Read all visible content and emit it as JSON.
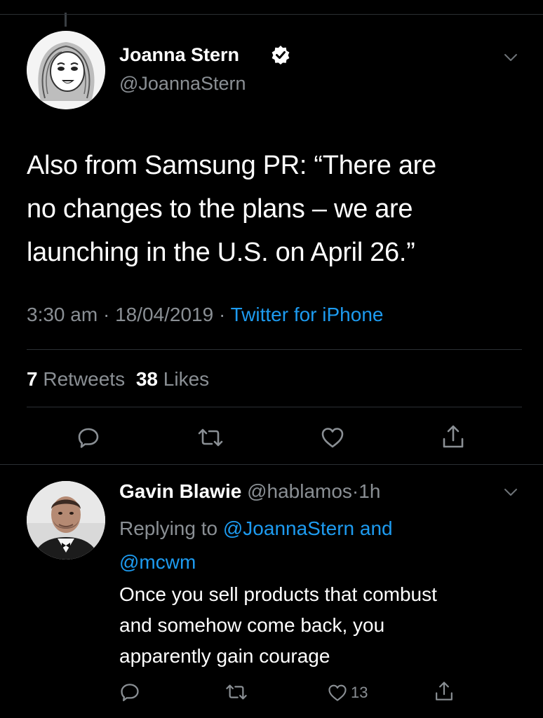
{
  "main_tweet": {
    "author_name": "Joanna Stern",
    "handle": "@JoannaStern",
    "text_lines": [
      "Also from Samsung PR: “There are",
      "no changes to the plans – we are",
      "launching in the U.S. on April 26.”"
    ],
    "time": "3:30 am",
    "dot": "·",
    "date": "18/04/2019",
    "source": "Twitter for iPhone",
    "retweets_count": "7",
    "retweets_label": "Retweets",
    "likes_count": "38",
    "likes_label": "Likes",
    "icons": {
      "verified": "verified-badge-icon",
      "more": "chevron-down-icon",
      "reply": "reply-icon",
      "retweet": "retweet-icon",
      "like": "heart-icon",
      "share": "share-icon"
    }
  },
  "reply_tweet": {
    "author_name": "Gavin Blawie",
    "handle": "@hablamos",
    "dot": "·",
    "time_ago": "1h",
    "replying_prefix": "Replying to",
    "replying_to_1": "@JoannaStern",
    "replying_and": "and",
    "replying_to_2": "@mcwm",
    "text_lines": [
      "Once you sell products that combust",
      "and somehow come back, you",
      "apparently gain courage"
    ],
    "like_count": "13"
  },
  "colors": {
    "background": "#000000",
    "text": "#ffffff",
    "muted": "#8a8f94",
    "link": "#1d9bf0",
    "divider": "#2b2f33"
  }
}
